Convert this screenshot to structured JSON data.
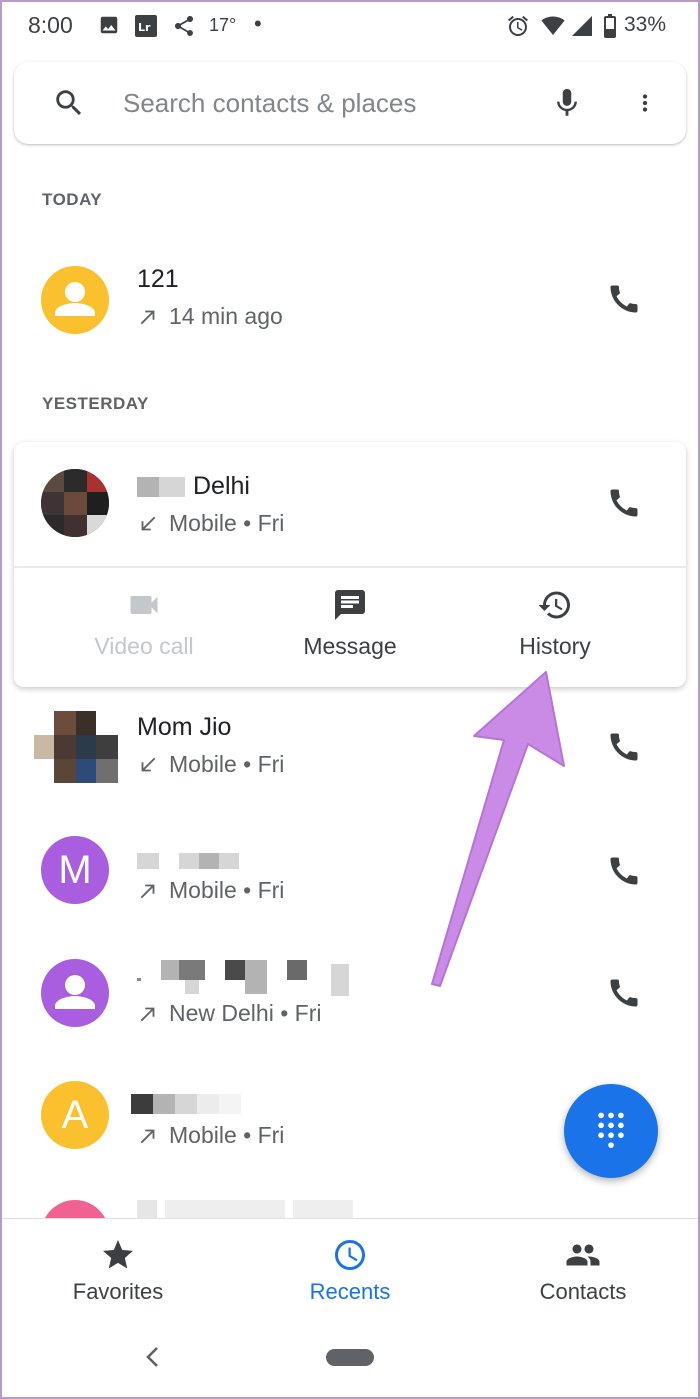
{
  "status_bar": {
    "time": "8:00",
    "temp": "17°",
    "battery": "33%"
  },
  "search": {
    "placeholder": "Search contacts & places"
  },
  "sections": {
    "today": "TODAY",
    "yesterday": "YESTERDAY"
  },
  "calls": [
    {
      "name": "121",
      "detail": "14 min ago",
      "direction": "outgoing"
    },
    {
      "name": "Delhi",
      "detail": "Mobile • Fri",
      "direction": "incoming"
    },
    {
      "name": "Mom Jio",
      "detail": "Mobile • Fri",
      "direction": "incoming"
    },
    {
      "name": "",
      "detail": "Mobile • Fri",
      "direction": "outgoing",
      "avatar_letter": "M"
    },
    {
      "name": "",
      "detail": "New Delhi • Fri",
      "direction": "outgoing"
    },
    {
      "name": "",
      "detail": "Mobile • Fri",
      "direction": "outgoing",
      "avatar_letter": "A"
    }
  ],
  "card_actions": {
    "video": "Video call",
    "message": "Message",
    "history": "History"
  },
  "nav": {
    "favorites": "Favorites",
    "recents": "Recents",
    "contacts": "Contacts"
  },
  "colors": {
    "accent": "#1a73e8",
    "yellow": "#fbc02d",
    "purple": "#a95ee0",
    "arrow": "#c98be5"
  }
}
